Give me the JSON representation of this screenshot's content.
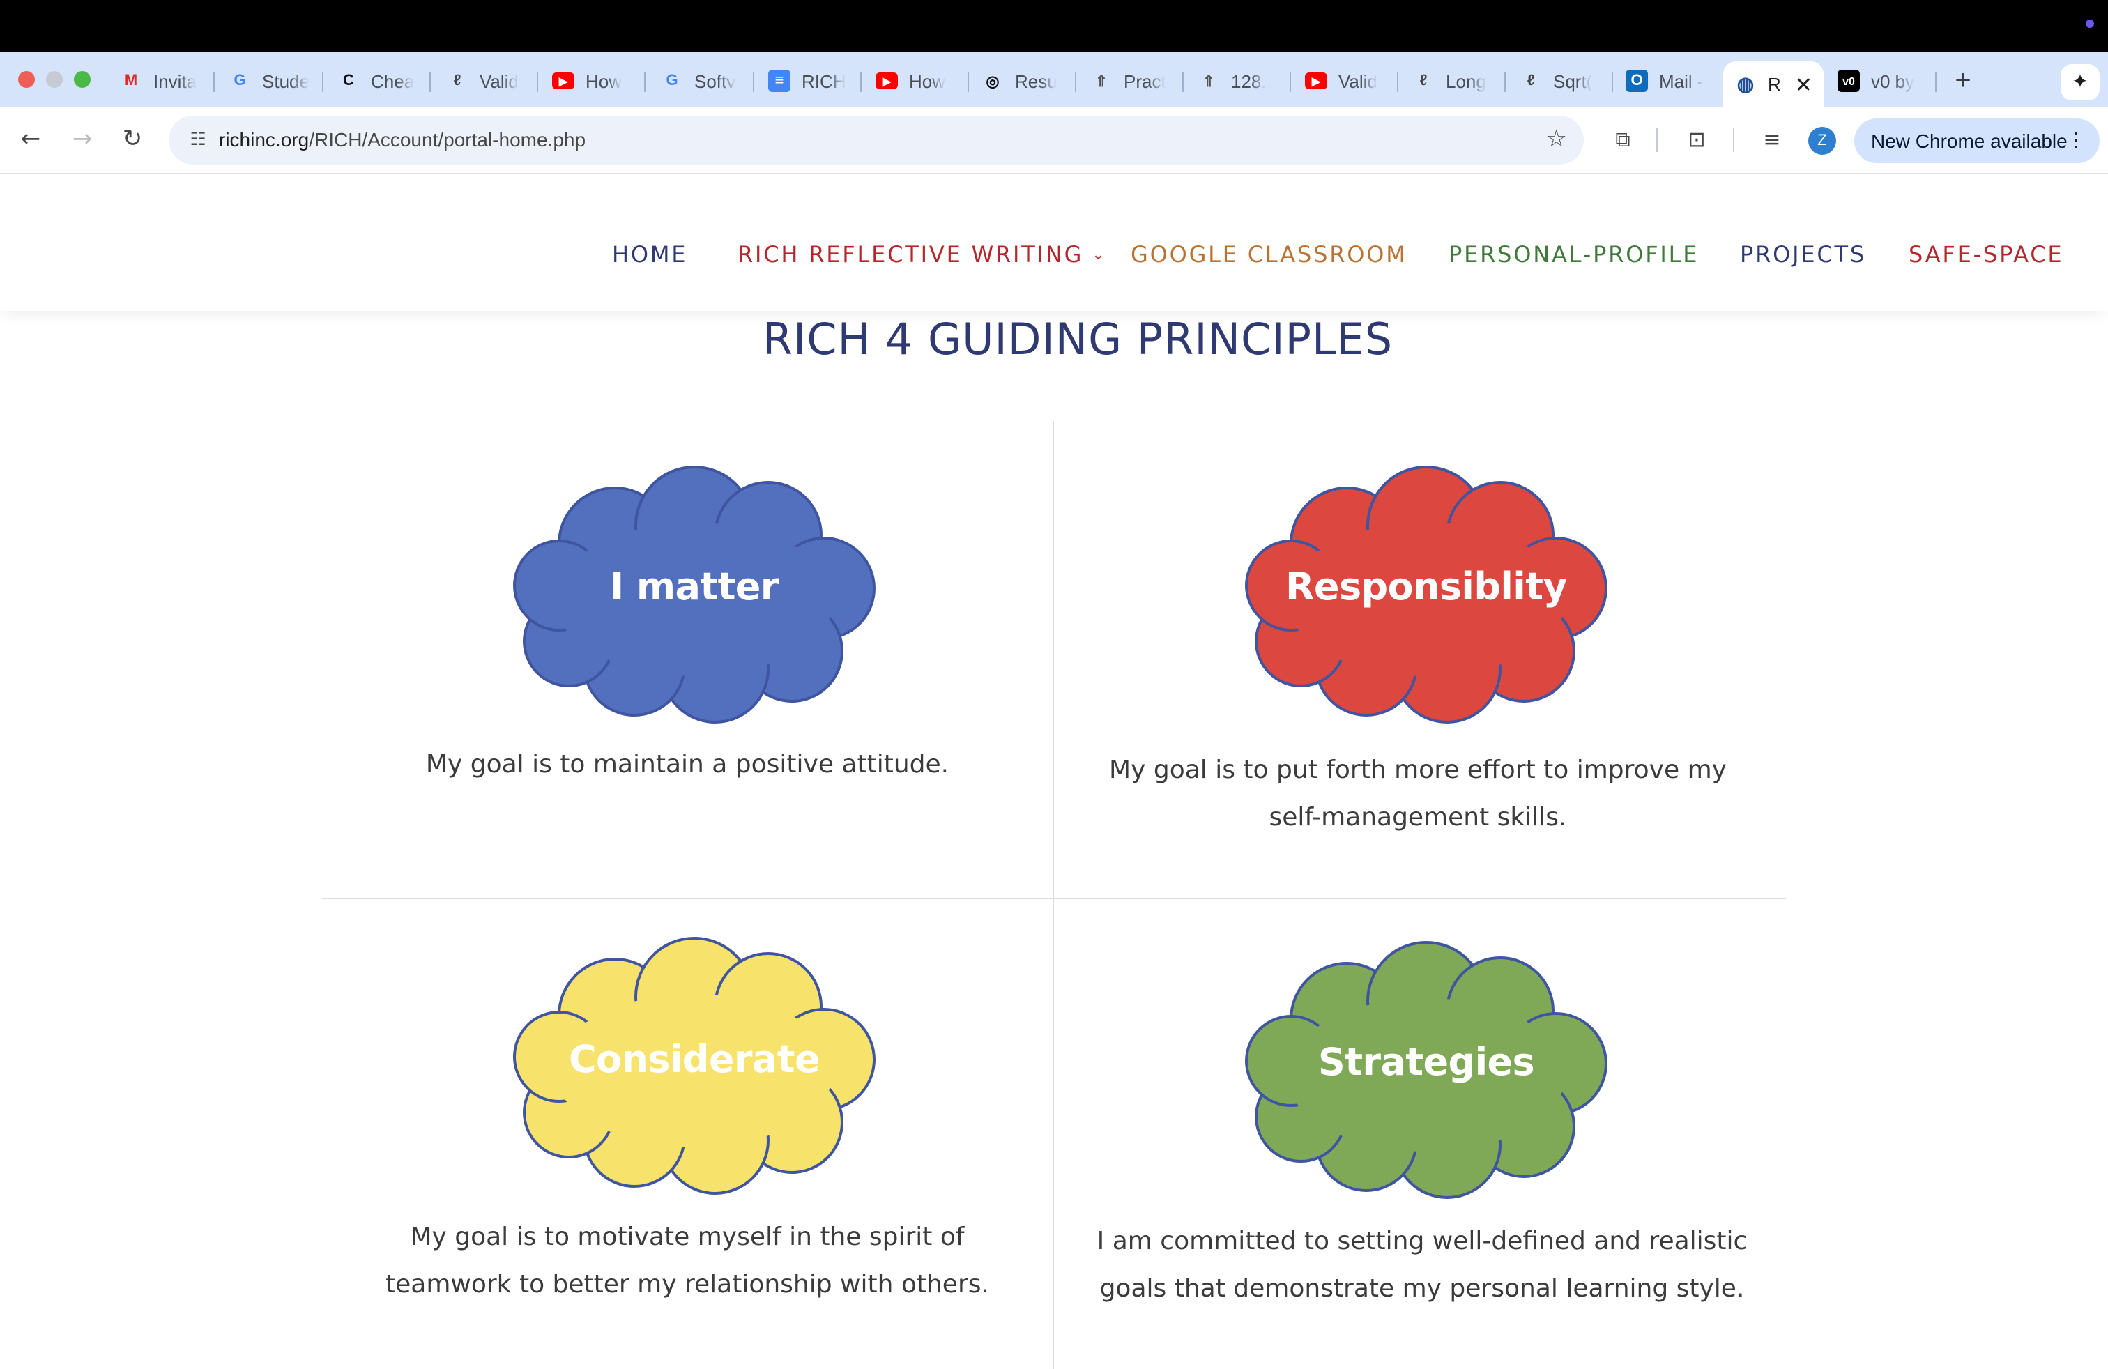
{
  "browser": {
    "tabs": [
      {
        "title": "Invita",
        "icon": "gmail-icon",
        "glyph": "M",
        "color": "#d93025"
      },
      {
        "title": "Stude",
        "icon": "google-icon",
        "glyph": "G",
        "color": "#4285f4"
      },
      {
        "title": "Chea",
        "icon": "chegg-icon",
        "glyph": "C",
        "color": "#111111"
      },
      {
        "title": "Valid",
        "icon": "leetcode-icon",
        "glyph": "ℓ",
        "color": "#444444"
      },
      {
        "title": "How",
        "icon": "youtube-icon",
        "glyph": "▶",
        "color": "#ff0000"
      },
      {
        "title": "Softv",
        "icon": "google-icon",
        "glyph": "G",
        "color": "#4285f4"
      },
      {
        "title": "RICH",
        "icon": "docs-icon",
        "glyph": "≡",
        "color": "#4285f4"
      },
      {
        "title": "How",
        "icon": "youtube-icon",
        "glyph": "▶",
        "color": "#ff0000"
      },
      {
        "title": "Resu",
        "icon": "chatgpt-icon",
        "glyph": "◎",
        "color": "#111111"
      },
      {
        "title": "Pract",
        "icon": "rocket-icon",
        "glyph": "⇑",
        "color": "#555555"
      },
      {
        "title": "128.",
        "icon": "rocket-icon",
        "glyph": "⇑",
        "color": "#555555"
      },
      {
        "title": "Valid",
        "icon": "youtube-icon",
        "glyph": "▶",
        "color": "#ff0000"
      },
      {
        "title": "Long",
        "icon": "leetcode-icon",
        "glyph": "ℓ",
        "color": "#444444"
      },
      {
        "title": "Sqrt(",
        "icon": "leetcode-icon",
        "glyph": "ℓ",
        "color": "#444444"
      },
      {
        "title": "Mail -",
        "icon": "outlook-icon",
        "glyph": "O",
        "color": "#0f6cbd"
      },
      {
        "title": "R",
        "icon": "globe-icon",
        "glyph": "◍",
        "color": "#1f4f99",
        "active": true
      },
      {
        "title": "v0 by",
        "icon": "v0-icon",
        "glyph": "v0",
        "color": "#000000"
      }
    ],
    "url_host": "richinc.org",
    "url_path": "/RICH/Account/portal-home.php",
    "profile_initial": "Z",
    "update_label": "New Chrome available"
  },
  "site": {
    "nav": [
      {
        "label": "HOME",
        "color": "#2f3a73"
      },
      {
        "label": "RICH REFLECTIVE WRITING",
        "color": "#b3262b",
        "dropdown": true
      },
      {
        "label": "GOOGLE CLASSROOM",
        "color": "#b87333"
      },
      {
        "label": "PERSONAL-PROFILE",
        "color": "#3f7a3a"
      },
      {
        "label": "PROJECTS",
        "color": "#2f3a73"
      },
      {
        "label": "SAFE-SPACE",
        "color": "#b3262b"
      }
    ],
    "heading": "RICH 4 GUIDING PRINCIPLES",
    "principles": [
      {
        "title": "I matter",
        "fill": "#5270be",
        "goal": "My goal is to maintain a positive attitude."
      },
      {
        "title": "Responsiblity",
        "fill": "#dc4740",
        "goal": "My goal is to put forth more effort to improve my self-management skills."
      },
      {
        "title": "Considerate",
        "fill": "#f7e36c",
        "goal": "My goal is to motivate myself in the spirit of teamwork to better my relationship with others."
      },
      {
        "title": "Strategies",
        "fill": "#7fa956",
        "goal": "I am committed to setting well-defined and realistic goals that demonstrate my personal learning style."
      }
    ]
  }
}
